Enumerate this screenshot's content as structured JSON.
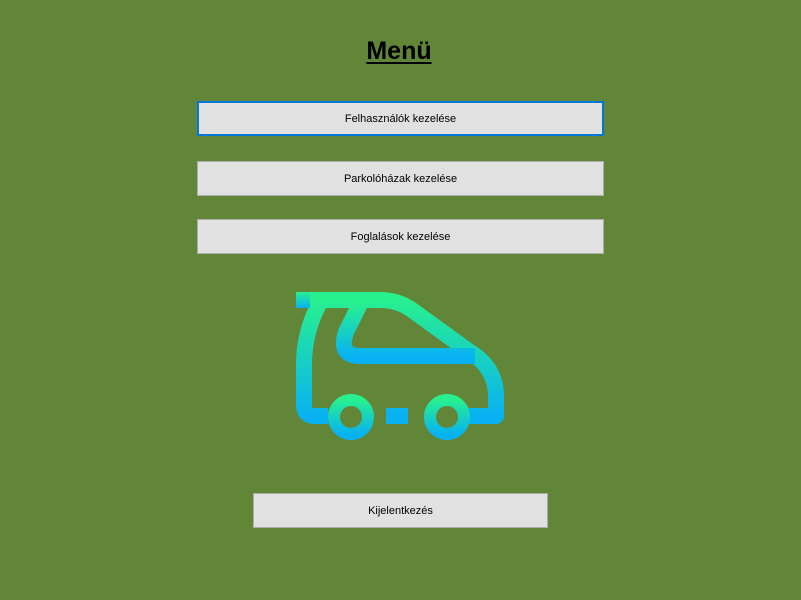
{
  "window": {
    "background_color": "#618638"
  },
  "menu": {
    "title": "Menü",
    "buttons": {
      "users": "Felhasználók kezelése",
      "garages": "Parkolóházak kezelése",
      "bookings": "Foglalások kezelése"
    },
    "logout": "Kijelentkezés"
  },
  "logo": {
    "icon": "car-icon",
    "gradient_top": "#28f08f",
    "gradient_bottom": "#08b2f2"
  },
  "colors": {
    "button_bg": "#e1e1e1",
    "focus_border": "#0078d7"
  }
}
